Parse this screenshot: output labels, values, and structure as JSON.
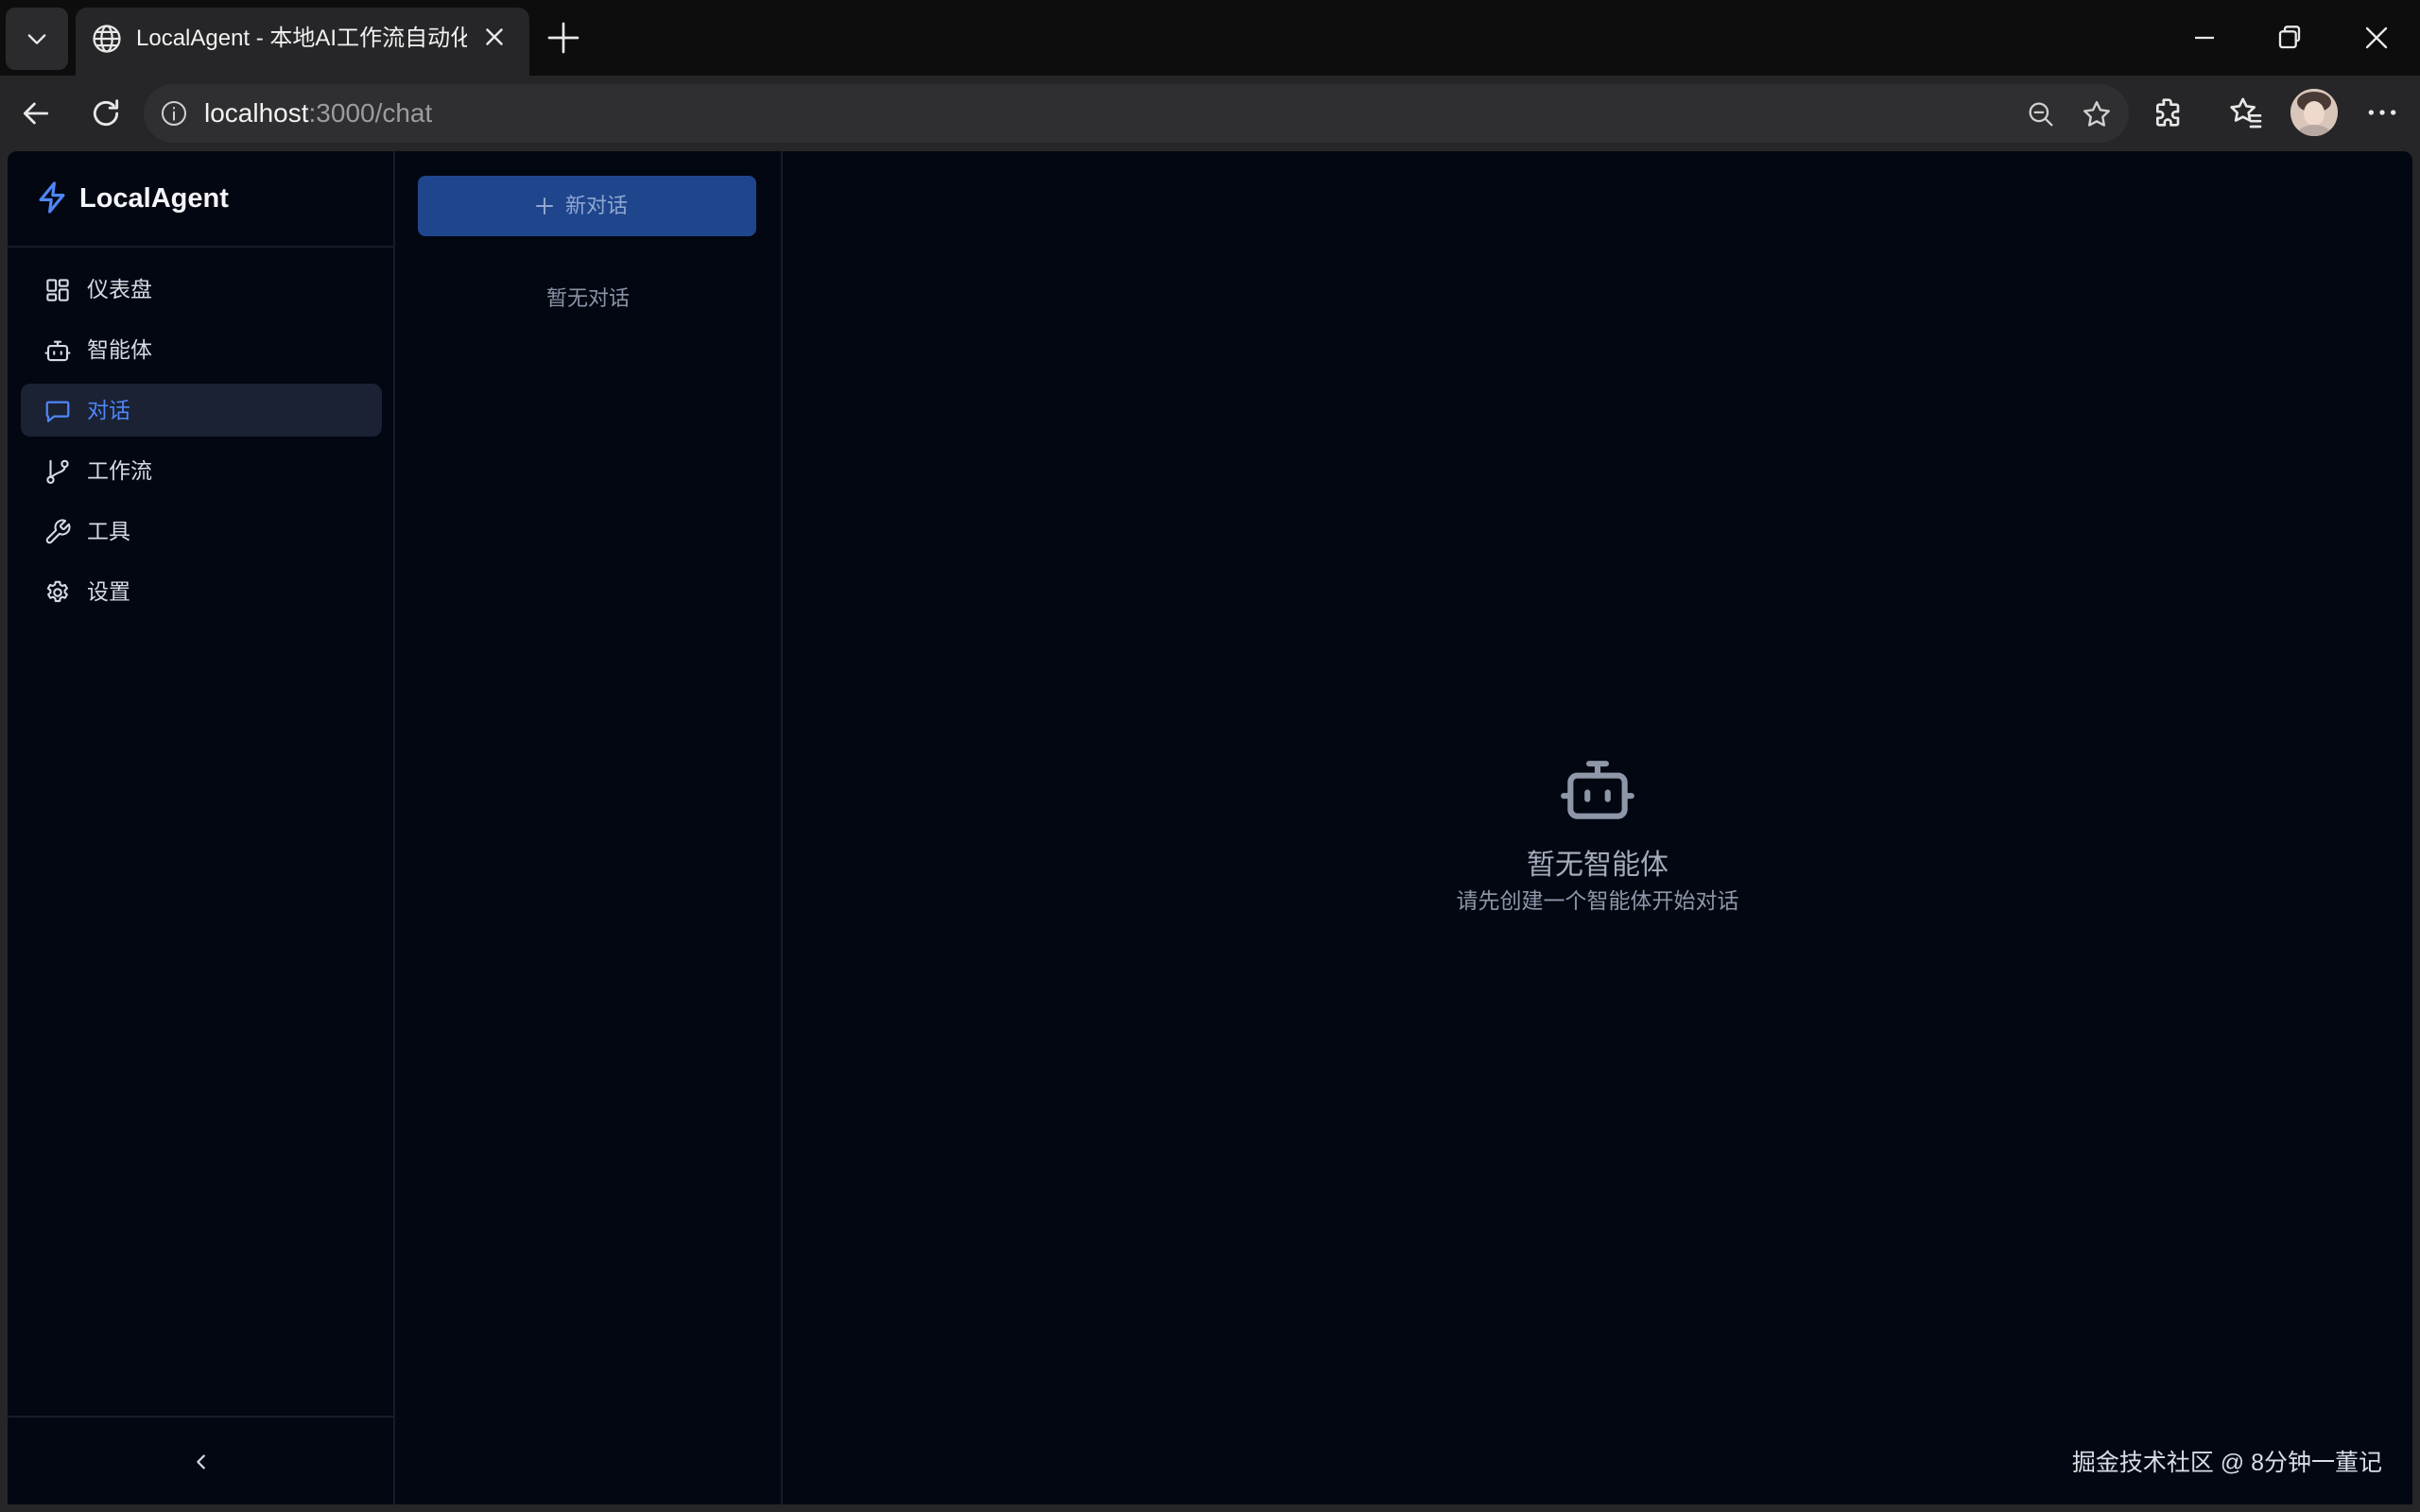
{
  "browser": {
    "tab_title": "LocalAgent - 本地AI工作流自动化平台",
    "url_host": "localhost",
    "url_path": ":3000/chat"
  },
  "app": {
    "brand": "LocalAgent",
    "nav": [
      {
        "label": "仪表盘",
        "icon": "dashboard-icon"
      },
      {
        "label": "智能体",
        "icon": "bot-icon"
      },
      {
        "label": "对话",
        "icon": "chat-icon",
        "active": true
      },
      {
        "label": "工作流",
        "icon": "workflow-icon"
      },
      {
        "label": "工具",
        "icon": "wrench-icon"
      },
      {
        "label": "设置",
        "icon": "gear-icon"
      }
    ],
    "new_chat_label": "新对话",
    "empty_conversations": "暂无对话",
    "empty_agent_title": "暂无智能体",
    "empty_agent_subtitle": "请先创建一个智能体开始对话"
  },
  "watermark": "掘金技术社区 @ 8分钟一董记",
  "colors": {
    "accent": "#4f86f7",
    "app_bg": "#030712",
    "button_bg": "#1f468c"
  }
}
